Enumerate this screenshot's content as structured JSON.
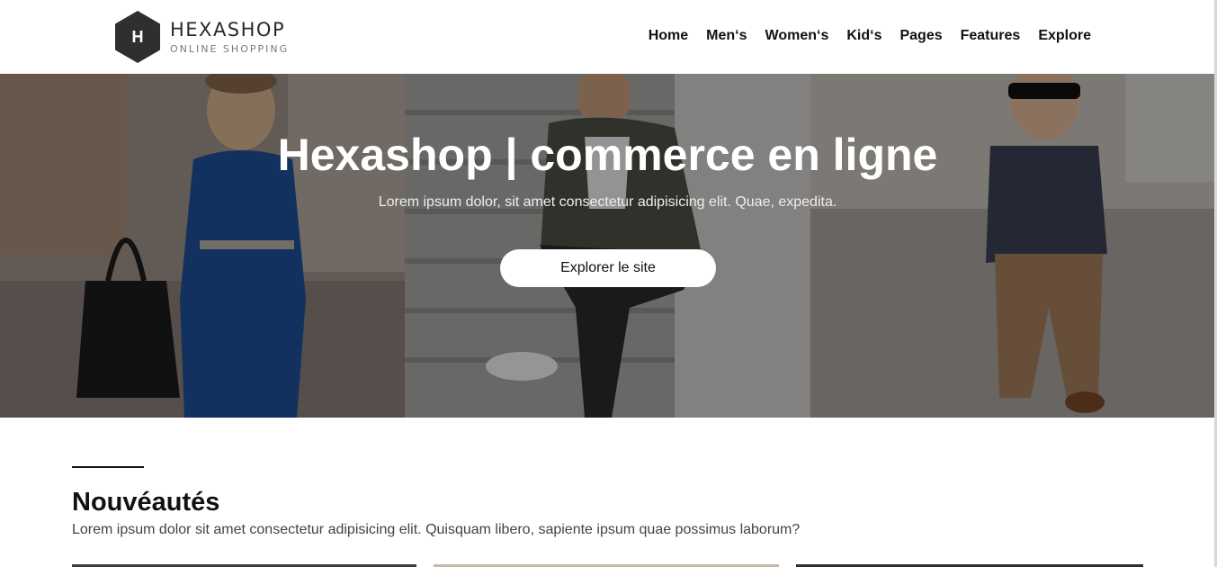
{
  "brand": {
    "logo_letter": "H",
    "name": "HEXASHOP",
    "tagline": "ONLINE SHOPPING",
    "logo_color": "#2f2f2f"
  },
  "nav": {
    "items": [
      {
        "label": "Home"
      },
      {
        "label": "Men‘s"
      },
      {
        "label": "Women‘s"
      },
      {
        "label": "Kid‘s"
      },
      {
        "label": "Pages"
      },
      {
        "label": "Features"
      },
      {
        "label": "Explore"
      }
    ]
  },
  "hero": {
    "title": "Hexashop | commerce en ligne",
    "subtitle": "Lorem ipsum dolor, sit amet consectetur adipisicing elit. Quae, expedita.",
    "cta_label": "Explorer le site",
    "panels": [
      "woman-in-blue-jumpsuit",
      "man-on-stairs",
      "child-in-sunglasses"
    ]
  },
  "section": {
    "title": "Nouvéautés",
    "description": "Lorem ipsum dolor sit amet consectetur adipisicing elit. Quisquam libero, sapiente ipsum quae possimus laborum?"
  }
}
